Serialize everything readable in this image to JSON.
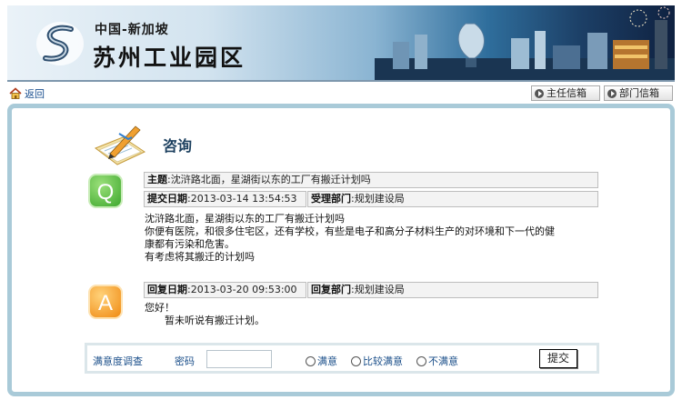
{
  "banner": {
    "country_line": "中国-新加坡",
    "park_name": "苏州工业园区"
  },
  "nav": {
    "back_label": "返回",
    "director_mailbox_label": "主任信箱",
    "dept_mailbox_label": "部门信箱"
  },
  "consult": {
    "title": "咨询",
    "question": {
      "badge": "Q",
      "subject_label": "主题",
      "subject_value": "沈浒路北面，星湖街以东的工厂有搬迁计划吗",
      "submit_date_label": "提交日期",
      "submit_date_value": "2013-03-14 13:54:53",
      "dept_label": "受理部门",
      "dept_value": "规划建设局",
      "body_lines": [
        "沈浒路北面，星湖街以东的工厂有搬迁计划吗",
        "你便有医院，和很多住宅区，还有学校，有些是电子和高分子材料生产的对环境和下一代的健",
        "康都有污染和危害。",
        "有考虑将其搬迁的计划吗"
      ]
    },
    "answer": {
      "badge": "A",
      "reply_date_label": "回复日期",
      "reply_date_value": "2013-03-20 09:53:00",
      "dept_label": "回复部门",
      "dept_value": "规划建设局",
      "greeting": "您好！",
      "reply_text": "暂未听说有搬迁计划。"
    }
  },
  "survey": {
    "title": "满意度调查",
    "password_label": "密码",
    "password_value": "",
    "options": [
      "满意",
      "比较满意",
      "不满意"
    ],
    "submit_label": "提交"
  },
  "colors": {
    "panel_border": "#a9cad8",
    "link_blue": "#1b4f8a",
    "q_badge": "#3ea82e",
    "a_badge": "#f08a12"
  },
  "icons": {
    "back": "home-icon",
    "nav_buttons": "circle-arrow-icon",
    "consult": "notepad-pencil-icon"
  }
}
